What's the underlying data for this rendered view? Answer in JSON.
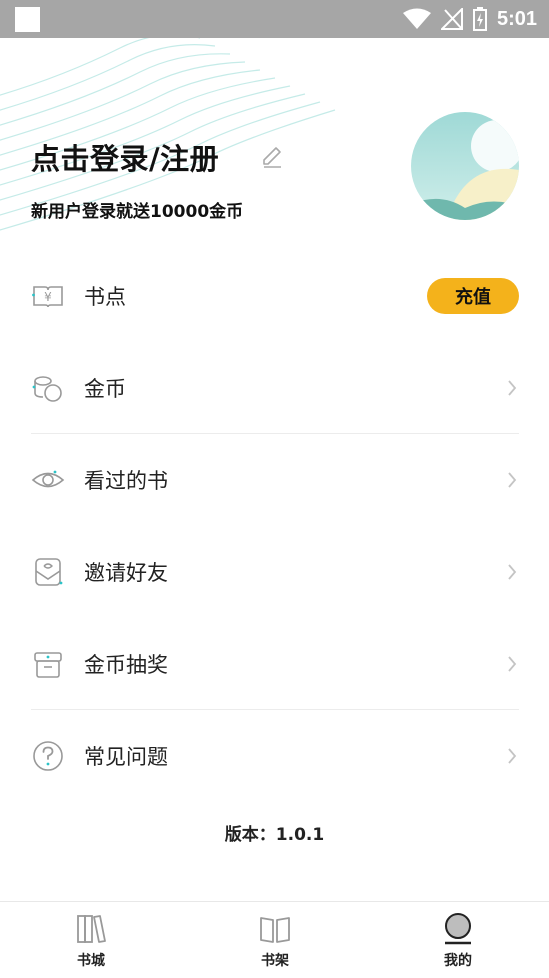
{
  "status_bar": {
    "time": "5:01"
  },
  "profile": {
    "login_prompt": "点击登录/注册",
    "promo": "新用户登录就送10000金币"
  },
  "menu": {
    "book_points": {
      "label": "书点",
      "action": "充值"
    },
    "coins": {
      "label": "金币"
    },
    "history": {
      "label": "看过的书"
    },
    "invite": {
      "label": "邀请好友"
    },
    "lottery": {
      "label": "金币抽奖"
    },
    "faq": {
      "label": "常见问题"
    }
  },
  "version_text": "版本：1.0.1",
  "tabs": [
    {
      "label": "书城"
    },
    {
      "label": "书架"
    },
    {
      "label": "我的"
    }
  ],
  "colors": {
    "accent": "#f4b21b",
    "teal": "#2cc3c8"
  }
}
